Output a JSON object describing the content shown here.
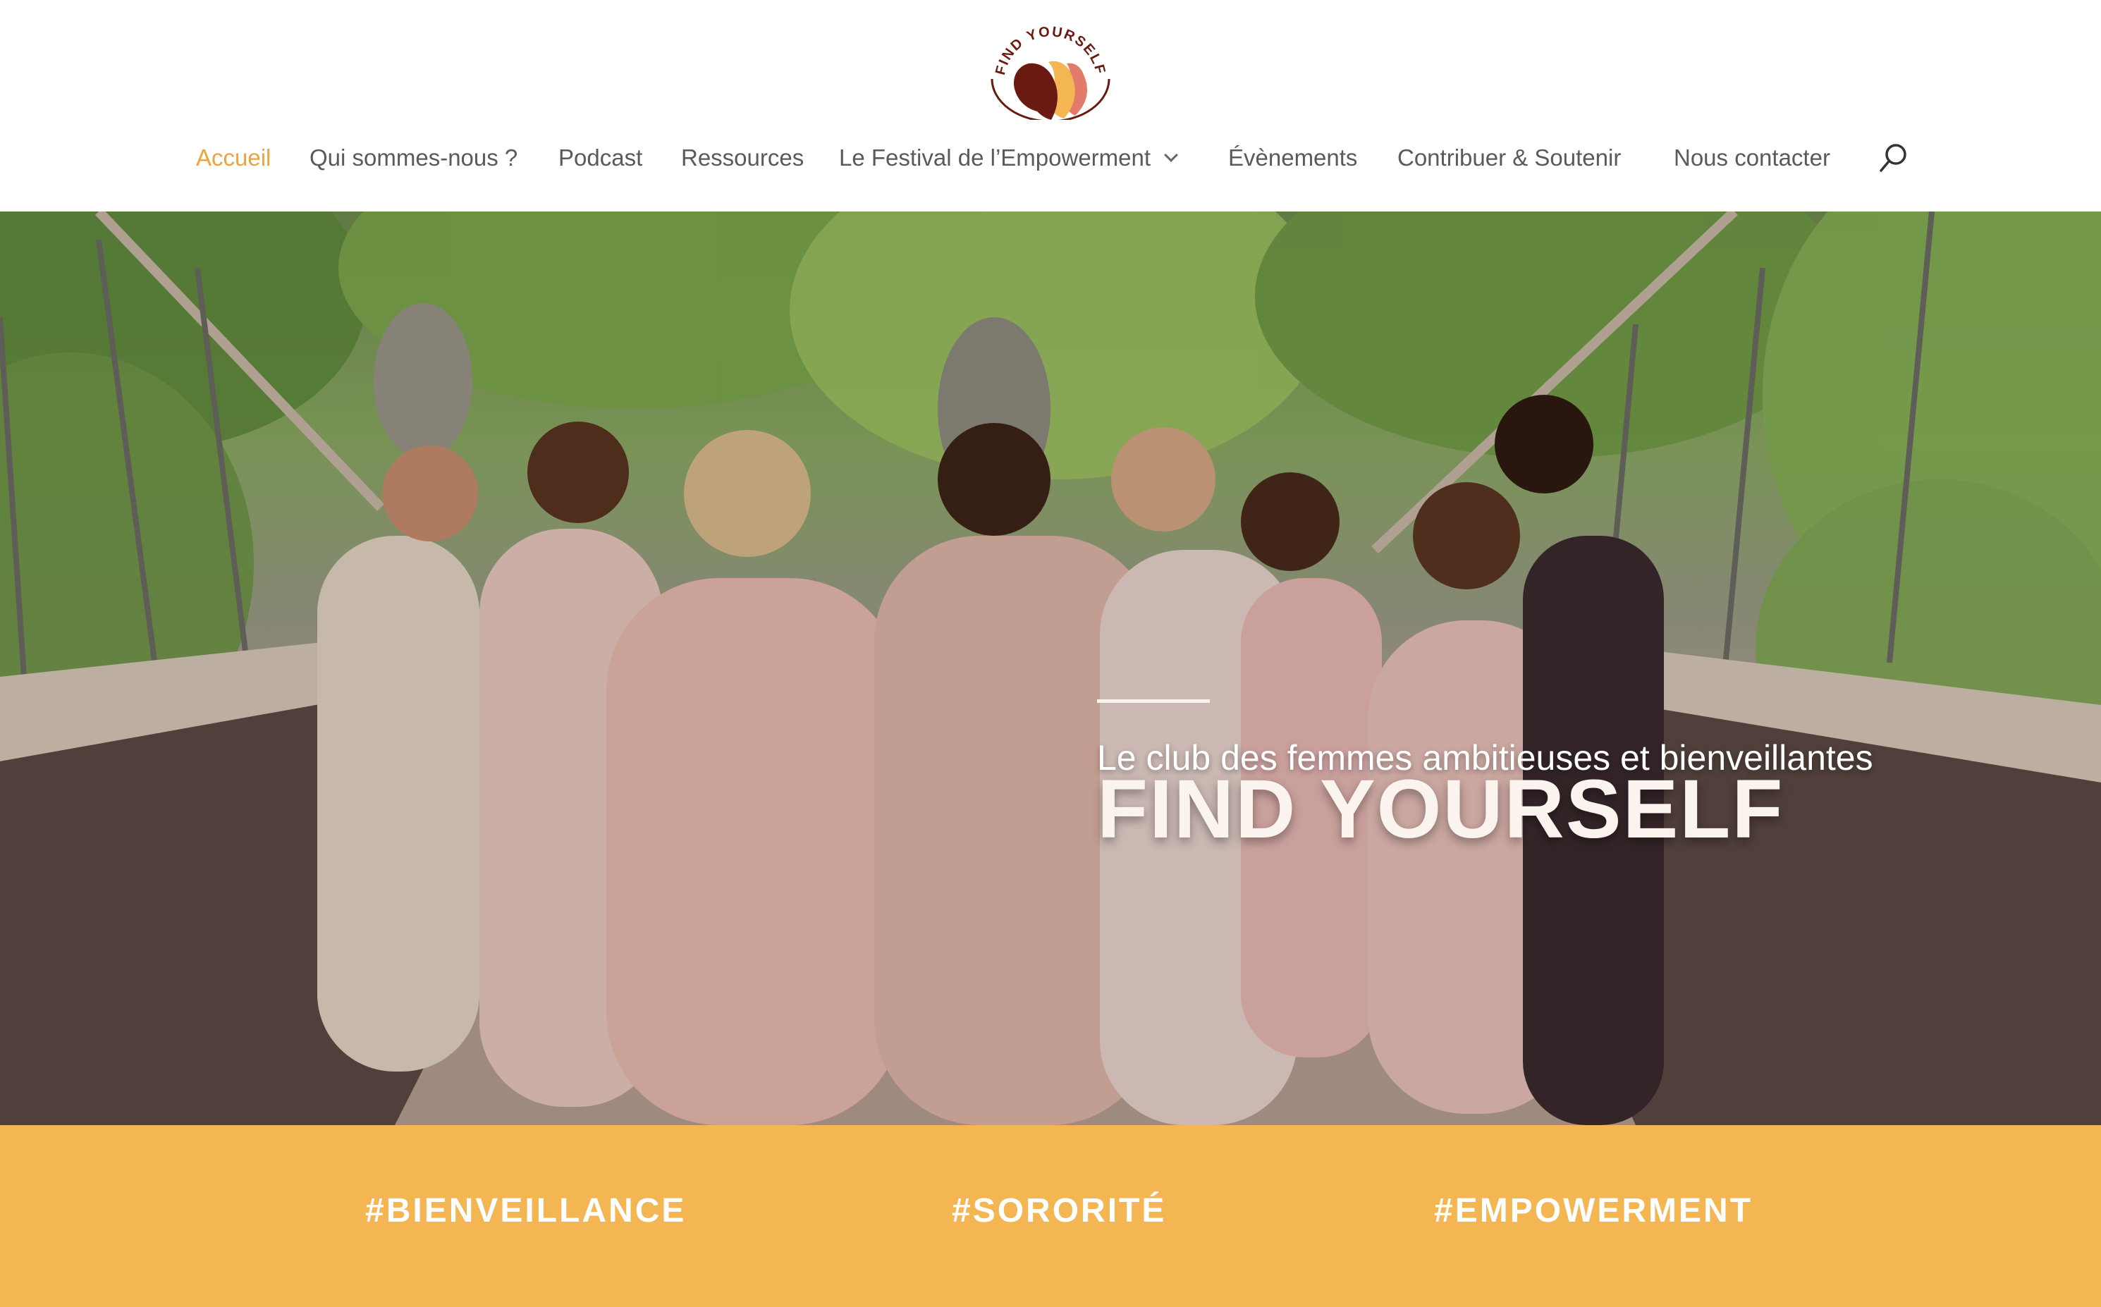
{
  "header": {
    "logo": {
      "text": "FIND YOURSELF",
      "colors": [
        "#6b1a12",
        "#f4b553",
        "#e47a6a"
      ]
    },
    "nav": [
      {
        "label": "Accueil",
        "active": true
      },
      {
        "label": "Qui sommes-nous ?"
      },
      {
        "label": "Podcast"
      },
      {
        "label": "Ressources"
      },
      {
        "label": "Le Festival de l’Empowerment",
        "has_dropdown": true
      },
      {
        "label": "Évènements"
      },
      {
        "label": "Contribuer & Soutenir"
      },
      {
        "label": "Nous contacter"
      }
    ],
    "search_icon": "search-icon"
  },
  "hero": {
    "title": "FIND YOURSELF",
    "subtitle": "Le club des femmes ambitieuses et bienveillantes"
  },
  "band": {
    "tags": [
      "#BIENVEILLANCE",
      "#SORORITÉ",
      "#EMPOWERMENT"
    ]
  },
  "colors": {
    "accent": "#eaa541",
    "band": "#f4b553",
    "nav_text": "#5a5a5a"
  }
}
